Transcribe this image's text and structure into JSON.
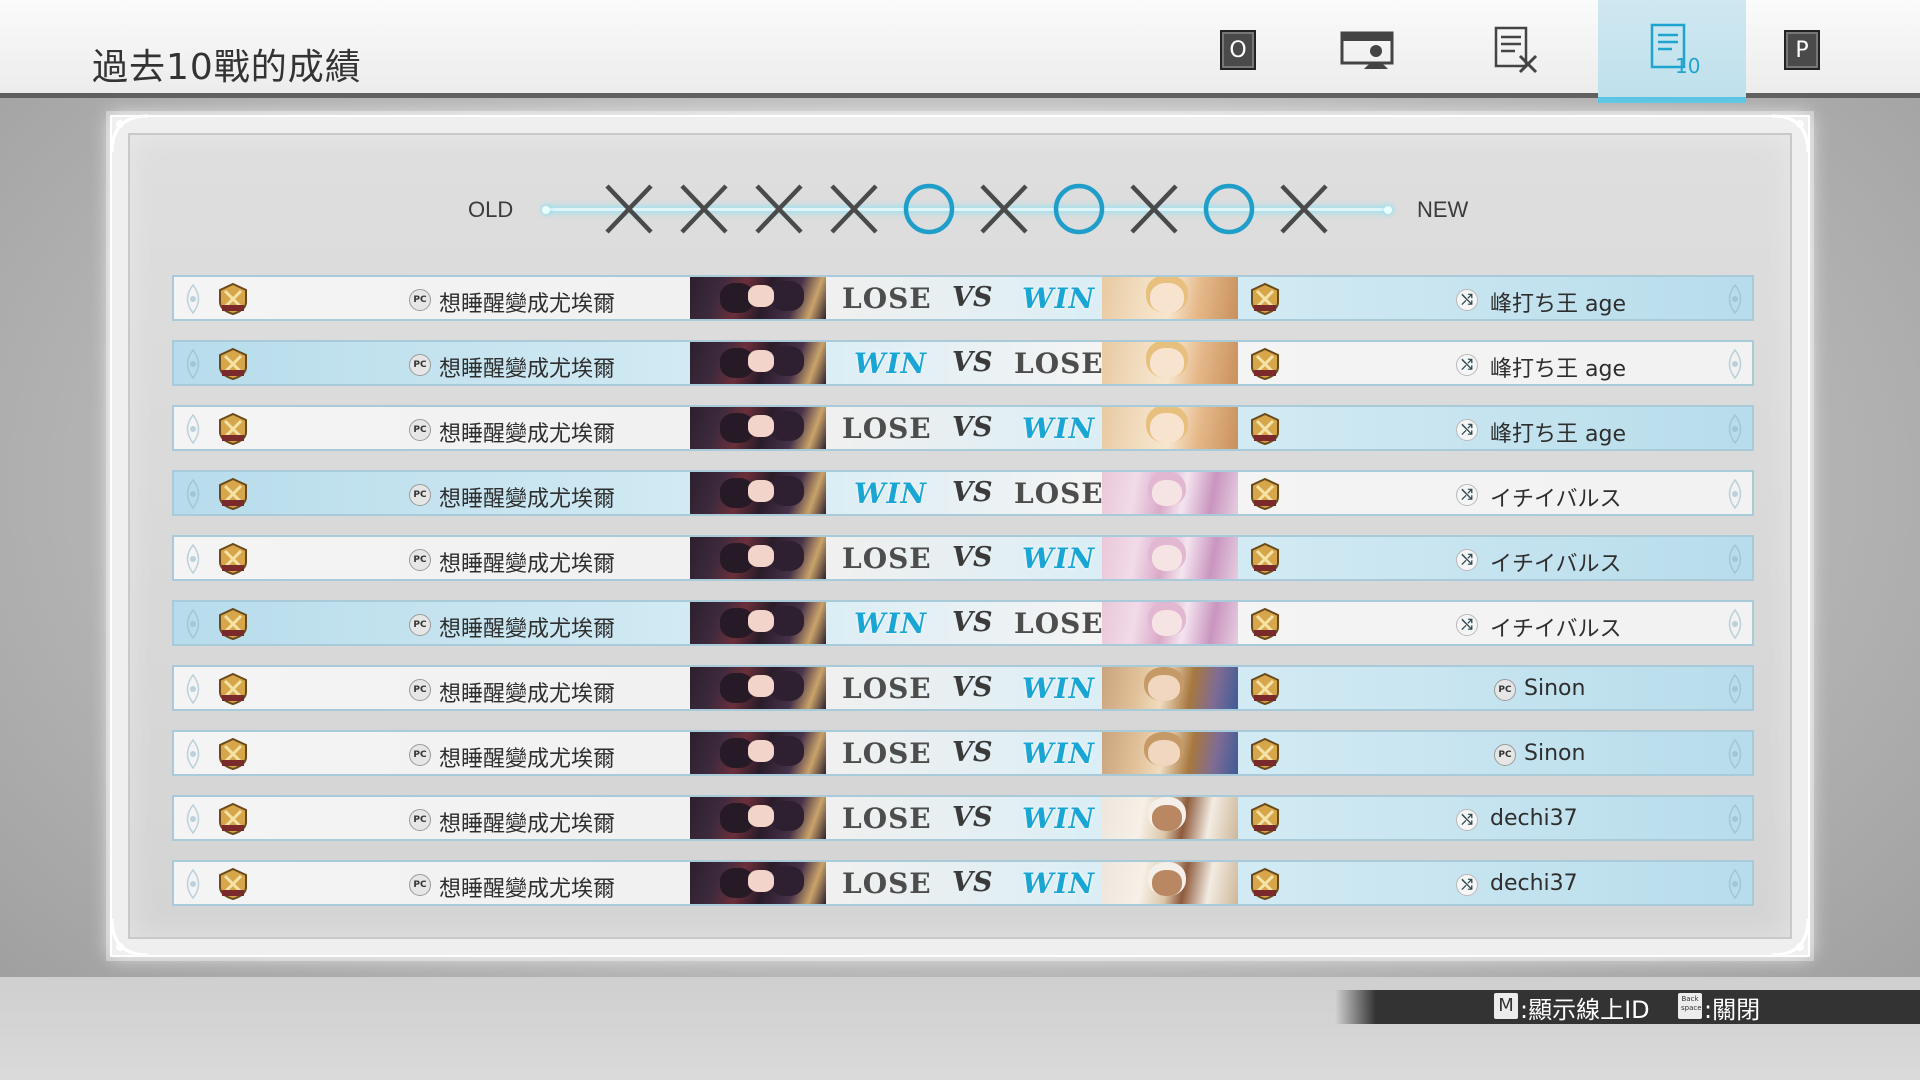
{
  "header": {
    "title": "過去10戰的成績",
    "nav": [
      {
        "name": "key-o-badge",
        "label": "O"
      },
      {
        "name": "player-card-tab",
        "icon": "player-card-icon"
      },
      {
        "name": "settings-list-tab",
        "icon": "list-edit-icon"
      },
      {
        "name": "recent-10-tab",
        "icon": "document-10-icon",
        "badge": "10",
        "active": true
      },
      {
        "name": "key-p-badge",
        "label": "P"
      }
    ]
  },
  "history": {
    "old_label": "OLD",
    "new_label": "NEW",
    "results": [
      "X",
      "X",
      "X",
      "X",
      "O",
      "X",
      "O",
      "X",
      "O",
      "X"
    ]
  },
  "matches": [
    {
      "left_platform": "PC",
      "left_name": "想睡醒變成尤埃爾",
      "left_result": "LOSE",
      "vs": "VS",
      "right_result": "WIN",
      "right_platform": "crossplay",
      "right_name": "峰打ち王 age",
      "right_character": "djeeta"
    },
    {
      "left_platform": "PC",
      "left_name": "想睡醒變成尤埃爾",
      "left_result": "WIN",
      "vs": "VS",
      "right_result": "LOSE",
      "right_platform": "crossplay",
      "right_name": "峰打ち王 age",
      "right_character": "djeeta"
    },
    {
      "left_platform": "PC",
      "left_name": "想睡醒變成尤埃爾",
      "left_result": "LOSE",
      "vs": "VS",
      "right_result": "WIN",
      "right_platform": "crossplay",
      "right_name": "峰打ち王 age",
      "right_character": "djeeta"
    },
    {
      "left_platform": "PC",
      "left_name": "想睡醒變成尤埃爾",
      "left_result": "WIN",
      "vs": "VS",
      "right_result": "LOSE",
      "right_platform": "crossplay",
      "right_name": "イチイバルス",
      "right_character": "narmaya"
    },
    {
      "left_platform": "PC",
      "left_name": "想睡醒變成尤埃爾",
      "left_result": "LOSE",
      "vs": "VS",
      "right_result": "WIN",
      "right_platform": "crossplay",
      "right_name": "イチイバルス",
      "right_character": "narmaya"
    },
    {
      "left_platform": "PC",
      "left_name": "想睡醒變成尤埃爾",
      "left_result": "WIN",
      "vs": "VS",
      "right_result": "LOSE",
      "right_platform": "crossplay",
      "right_name": "イチイバルス",
      "right_character": "narmaya"
    },
    {
      "left_platform": "PC",
      "left_name": "想睡醒變成尤埃爾",
      "left_result": "LOSE",
      "vs": "VS",
      "right_result": "WIN",
      "right_platform": "PC",
      "right_name": "Sinon",
      "right_character": "katalina"
    },
    {
      "left_platform": "PC",
      "left_name": "想睡醒變成尤埃爾",
      "left_result": "LOSE",
      "vs": "VS",
      "right_result": "WIN",
      "right_platform": "PC",
      "right_name": "Sinon",
      "right_character": "katalina"
    },
    {
      "left_platform": "PC",
      "left_name": "想睡醒變成尤埃爾",
      "left_result": "LOSE",
      "vs": "VS",
      "right_result": "WIN",
      "right_platform": "crossplay",
      "right_name": "dechi37",
      "right_character": "zooey"
    },
    {
      "left_platform": "PC",
      "left_name": "想睡醒變成尤埃爾",
      "left_result": "LOSE",
      "vs": "VS",
      "right_result": "WIN",
      "right_platform": "crossplay",
      "right_name": "dechi37",
      "right_character": "zooey"
    }
  ],
  "footer": {
    "show_id_key": "M",
    "show_id_label": ":顯示線上ID",
    "close_key": "Back space",
    "close_label": ":關閉"
  },
  "colors": {
    "accent": "#1aa6d4",
    "win_row": "#b7dceb",
    "header_border": "#5f5f5f",
    "history_line": "#bfeef6"
  }
}
